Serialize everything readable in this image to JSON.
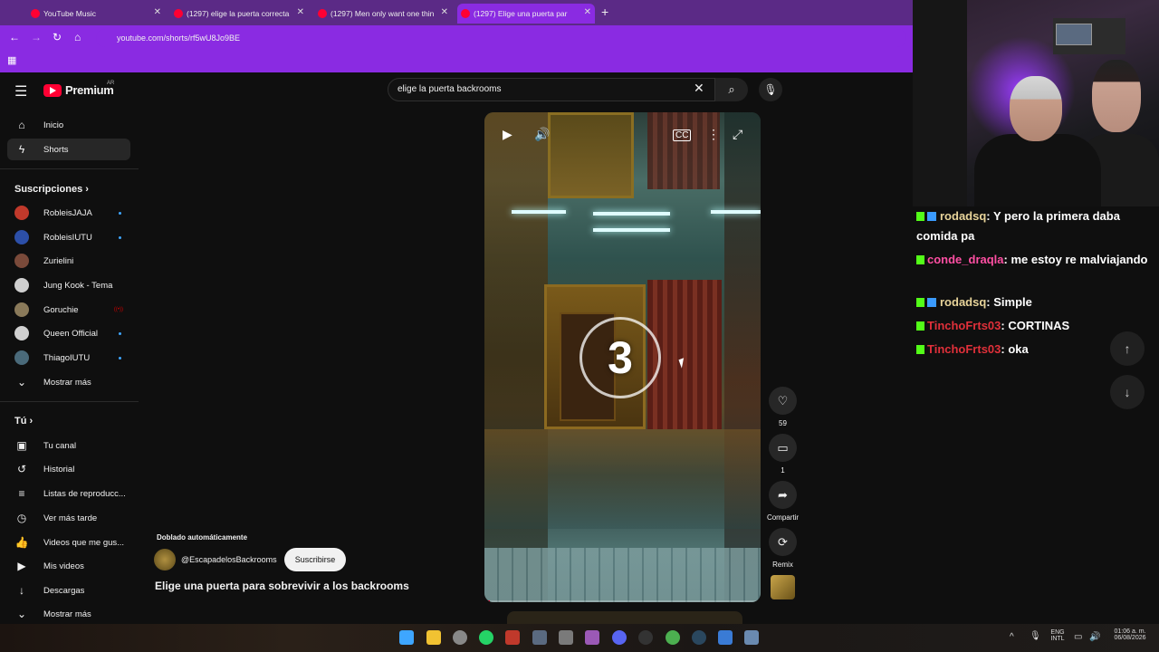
{
  "browser": {
    "tabs": [
      {
        "title": "YouTube Music"
      },
      {
        "title": "(1297) elige la puerta correcta"
      },
      {
        "title": "(1297) Men only want one thin"
      },
      {
        "title": "(1297) Elige una puerta par"
      }
    ],
    "url": "youtube.com/shorts/rf5wU8Jo9BE"
  },
  "masthead": {
    "logo": "Premium",
    "country": "AR",
    "search_value": "elige la puerta backrooms"
  },
  "sidebar": {
    "main": [
      {
        "label": "Inicio",
        "icon": "home-icon"
      },
      {
        "label": "Shorts",
        "icon": "shorts-icon"
      }
    ],
    "subs_heading": "Suscripciones",
    "subs": [
      {
        "label": "RobleisJAJA",
        "color": "#c0392b"
      },
      {
        "label": "RobleisIUTU",
        "color": "#2c4fa8"
      },
      {
        "label": "Zurielini",
        "color": "#7a4a3a"
      },
      {
        "label": "Jung Kook - Tema",
        "color": "#cfcfcf"
      },
      {
        "label": "Goruchie",
        "color": "#8a7a5a"
      },
      {
        "label": "Queen Official",
        "color": "#d0d0d0"
      },
      {
        "label": "ThiagoIUTU",
        "color": "#4a6a7a"
      }
    ],
    "show_more": "Mostrar más",
    "you_heading": "Tú",
    "you": [
      {
        "label": "Tu canal",
        "icon": "channel-icon"
      },
      {
        "label": "Historial",
        "icon": "history-icon"
      },
      {
        "label": "Listas de reproducc...",
        "icon": "playlist-icon"
      },
      {
        "label": "Ver más tarde",
        "icon": "clock-icon"
      },
      {
        "label": "Videos que me gus...",
        "icon": "thumb-up-icon"
      },
      {
        "label": "Mis videos",
        "icon": "video-icon"
      },
      {
        "label": "Descargas",
        "icon": "download-icon"
      }
    ],
    "show_more_2": "Mostrar más"
  },
  "short": {
    "countdown": "3",
    "likes": "59",
    "comments": "1",
    "share_label": "Compartir",
    "remix_label": "Remix",
    "dub_label": "Doblado automáticamente",
    "channel": "@EscapadelosBackrooms",
    "subscribe_label": "Suscribirse",
    "title": "Elige una puerta para sobrevivir a los backrooms",
    "progress": 0.02
  },
  "chat": [
    {
      "user": "rodadsq",
      "text": ": Y pero la primera daba comida pa",
      "color": "#e8d49a"
    },
    {
      "user": "conde_draqla",
      "text": ": me estoy re malviajando",
      "color": "#ff4fa3"
    },
    {
      "user": "rodadsq",
      "text": ": Simple",
      "color": "#e8d49a"
    },
    {
      "user": "TinchoFrts03",
      "text": ": CORTINAS",
      "color": "#e0303a"
    },
    {
      "user": "TinchoFrts03",
      "text": ": oka",
      "color": "#e0303a"
    }
  ],
  "tray": {
    "lang1": "ENG",
    "lang2": "INTL",
    "time": "01:06 a. m.",
    "date": "06/08/2026"
  }
}
